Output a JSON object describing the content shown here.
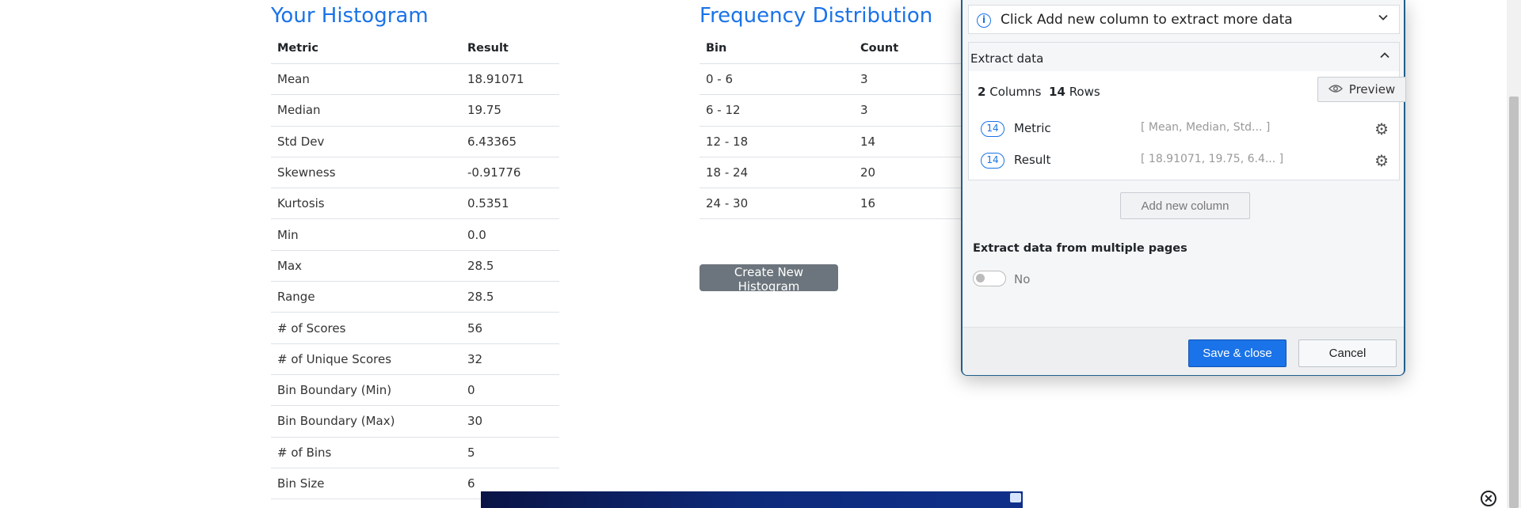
{
  "histogram": {
    "title": "Your Histogram",
    "headers": [
      "Metric",
      "Result"
    ],
    "rows": [
      [
        "Mean",
        "18.91071"
      ],
      [
        "Median",
        "19.75"
      ],
      [
        "Std Dev",
        "6.43365"
      ],
      [
        "Skewness",
        "-0.91776"
      ],
      [
        "Kurtosis",
        "0.5351"
      ],
      [
        "Min",
        "0.0"
      ],
      [
        "Max",
        "28.5"
      ],
      [
        "Range",
        "28.5"
      ],
      [
        "# of Scores",
        "56"
      ],
      [
        "# of Unique Scores",
        "32"
      ],
      [
        "Bin Boundary (Min)",
        "0"
      ],
      [
        "Bin Boundary (Max)",
        "30"
      ],
      [
        "# of Bins",
        "5"
      ],
      [
        "Bin Size",
        "6"
      ]
    ]
  },
  "frequency": {
    "title": "Frequency Distribution",
    "headers": [
      "Bin",
      "Count"
    ],
    "rows": [
      [
        "0 - 6",
        "3"
      ],
      [
        "6 - 12",
        "3"
      ],
      [
        "12 - 18",
        "14"
      ],
      [
        "18 - 24",
        "20"
      ],
      [
        "24 - 30",
        "16"
      ]
    ],
    "create_button": "Create New Histogram"
  },
  "panel": {
    "info_text": "Click Add new column to extract more data",
    "extract_title": "Extract data",
    "columns_count": "2",
    "columns_label": "Columns",
    "rows_count": "14",
    "rows_label": "Rows",
    "preview_label": "Preview",
    "columns": [
      {
        "count": "14",
        "name": "Metric",
        "values": "[ Mean, Median, Std...  ]"
      },
      {
        "count": "14",
        "name": "Result",
        "values": "[ 18.91071, 19.75, 6.4...  ]"
      }
    ],
    "add_column_label": "Add new column",
    "multi_page_label": "Extract data from multiple pages",
    "toggle_label": "No",
    "save_label": "Save & close",
    "cancel_label": "Cancel"
  },
  "icons": {
    "info": "info-icon",
    "chevron_down": "chevron-down-icon",
    "chevron_up": "chevron-up-icon",
    "eye": "eye-icon",
    "gear": "gear-icon",
    "close": "close-icon"
  },
  "colors": {
    "accent": "#1a73e8",
    "panel_border": "#1f5f8b",
    "button_dark": "#6c757d"
  }
}
